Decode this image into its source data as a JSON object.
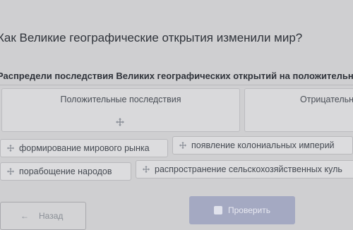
{
  "question": "Как Великие географические открытия изменили мир?",
  "instruction": "Распредели последствия Великих географических открытий на положительн",
  "columns": {
    "positive": "Положительные последствия",
    "negative": "Отрицательны"
  },
  "chips": [
    "формирование мирового рынка",
    "появление колониальных империй",
    "порабощение народов",
    "распространение сельскохозяйственных куль"
  ],
  "buttons": {
    "back": "Назад",
    "check": "Проверить"
  },
  "icons": {
    "drop_target": "move-cross-icon",
    "chip_handle": "move-cross-icon",
    "back": "arrow-left-icon",
    "check": "check-box-icon"
  },
  "colors": {
    "accent": "#a4a9c2",
    "chip_icon": "#8a8f98"
  }
}
